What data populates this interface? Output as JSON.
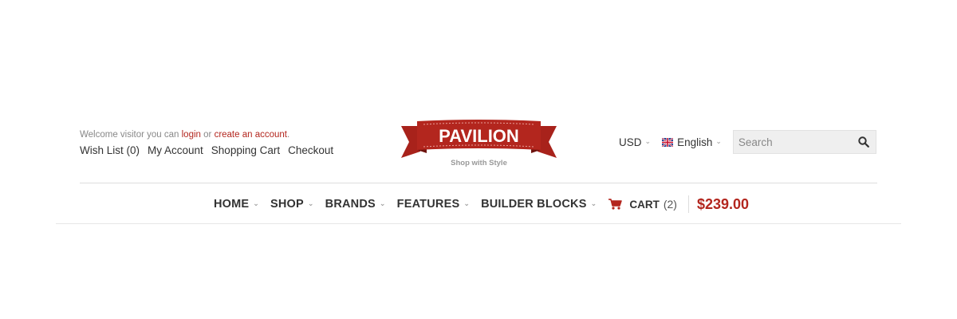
{
  "header": {
    "welcome": {
      "prefix": "Welcome visitor you can ",
      "login": "login",
      "middle": " or ",
      "create": "create an account",
      "suffix": "."
    },
    "links": [
      "Wish List (0)",
      "My Account",
      "Shopping Cart",
      "Checkout"
    ],
    "logo": {
      "text": "PAVILION",
      "tagline": "Shop with Style"
    },
    "currency": "USD",
    "language": "English",
    "search": {
      "placeholder": "Search"
    }
  },
  "nav": {
    "items": [
      "HOME",
      "SHOP",
      "BRANDS",
      "FEATURES",
      "BUILDER BLOCKS"
    ],
    "cart": {
      "label": "CART",
      "count": "(2)",
      "total": "$239.00"
    }
  },
  "colors": {
    "accent": "#b3261e",
    "ribbon_dark": "#8e1a14",
    "text": "#333333"
  },
  "icons": {
    "search": "search-icon",
    "cart": "cart-icon",
    "flag": "uk-flag-icon",
    "chevron": "chevron-down-icon"
  }
}
